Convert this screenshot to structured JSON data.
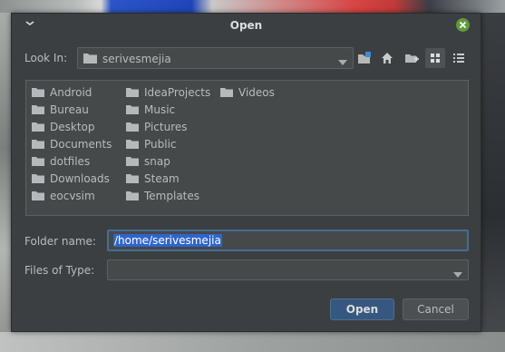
{
  "window": {
    "title": "Open"
  },
  "look_in": {
    "label": "Look In:",
    "value": "serivesmejia"
  },
  "toolbar": {
    "icons": [
      "new-folder-icon",
      "home-icon",
      "folder-up-icon",
      "list-view-icon",
      "details-view-icon"
    ]
  },
  "files": {
    "columns": [
      [
        "Android",
        "Bureau",
        "Desktop",
        "Documents",
        "dotfiles",
        "Downloads",
        "eocvsim"
      ],
      [
        "IdeaProjects",
        "Music",
        "Pictures",
        "Public",
        "snap",
        "Steam",
        "Templates"
      ],
      [
        "Videos"
      ]
    ]
  },
  "folder_name": {
    "label": "Folder name:",
    "value": "/home/serivesmejia"
  },
  "file_type": {
    "label": "Files of Type:",
    "value": ""
  },
  "buttons": {
    "open": "Open",
    "cancel": "Cancel"
  },
  "colors": {
    "accent": "#365880",
    "selection": "#2f65ca",
    "close": "#5f9a3b",
    "panel": "#3c3f41"
  }
}
